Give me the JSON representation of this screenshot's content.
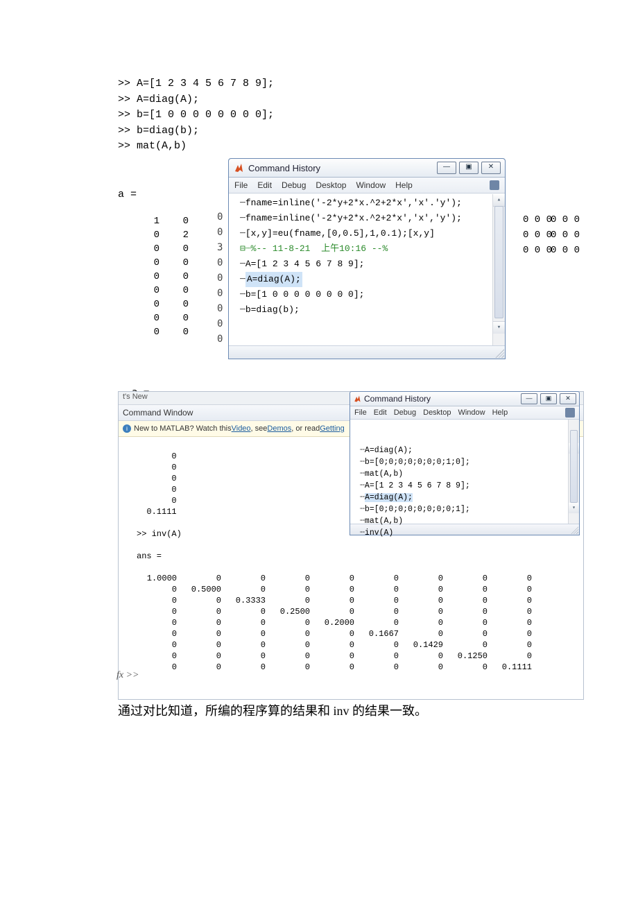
{
  "shot1": {
    "cmd_lines": ">> A=[1 2 3 4 5 6 7 8 9];\n>> A=diag(A);\n>> b=[1 0 0 0 0 0 0 0 0];\n>> b=diag(b);\n>> mat(A,b)",
    "a_equals": "a =",
    "matrix_left": [
      [
        "1",
        "0"
      ],
      [
        "0",
        "2"
      ],
      [
        "0",
        "0"
      ],
      [
        "0",
        "0"
      ],
      [
        "0",
        "0"
      ],
      [
        "0",
        "0"
      ],
      [
        "0",
        "0"
      ],
      [
        "0",
        "0"
      ],
      [
        "0",
        "0"
      ]
    ],
    "gutter": "0\n0\n3\n0\n0\n0\n0\n0\n0",
    "right_col": [
      "0",
      "0",
      "0",
      "0",
      "0",
      "0",
      "0",
      "0",
      "0"
    ],
    "a_bottom": "a ="
  },
  "winA": {
    "title": "Command History",
    "menus": [
      "File",
      "Edit",
      "Debug",
      "Desktop",
      "Window",
      "Help"
    ],
    "winbtns": {
      "min": "—",
      "max": "▣",
      "close": "✕"
    },
    "scroll": {
      "up": "▴",
      "down": "▾"
    },
    "lines": [
      {
        "text": "fname=inline('-2*y+2*x.^2+2*x','x'.'y');",
        "sel": false
      },
      {
        "text": "fname=inline('-2*y+2*x.^2+2*x','x','y');",
        "sel": false
      },
      {
        "text": "[x,y]=eu(fname,[0,0.5],1,0.1);[x,y]",
        "sel": false
      },
      {
        "text": "%-- 11-8-21  上午10:16 --%",
        "sel": false,
        "green": true,
        "toggle": "⊟"
      },
      {
        "text": "A=[1 2 3 4 5 6 7 8 9];",
        "sel": false
      },
      {
        "text": "A=diag(A);",
        "sel": true
      },
      {
        "text": "b=[1 0 0 0 0 0 0 0 0];",
        "sel": false
      },
      {
        "text": "b=diag(b);",
        "sel": false
      }
    ]
  },
  "shot2": {
    "wsbar": "t's New",
    "cwbar": "Command Window",
    "info_prefix": "New to MATLAB? Watch this ",
    "info_link1": "Video",
    "info_mid": ", see ",
    "info_link2": "Demos",
    "info_suffix": ", or read ",
    "info_link3": "Getting",
    "leading_zeros": [
      "0",
      "0",
      "0",
      "0",
      "0",
      "0.1111"
    ],
    "inv_cmd": ">> inv(A)",
    "ans_label": "ans =",
    "matrix": [
      [
        "1.0000",
        "0",
        "0",
        "0",
        "0",
        "0",
        "0",
        "0",
        "0"
      ],
      [
        "0",
        "0.5000",
        "0",
        "0",
        "0",
        "0",
        "0",
        "0",
        "0"
      ],
      [
        "0",
        "0",
        "0.3333",
        "0",
        "0",
        "0",
        "0",
        "0",
        "0"
      ],
      [
        "0",
        "0",
        "0",
        "0.2500",
        "0",
        "0",
        "0",
        "0",
        "0"
      ],
      [
        "0",
        "0",
        "0",
        "0",
        "0.2000",
        "0",
        "0",
        "0",
        "0"
      ],
      [
        "0",
        "0",
        "0",
        "0",
        "0",
        "0.1667",
        "0",
        "0",
        "0"
      ],
      [
        "0",
        "0",
        "0",
        "0",
        "0",
        "0",
        "0.1429",
        "0",
        "0"
      ],
      [
        "0",
        "0",
        "0",
        "0",
        "0",
        "0",
        "0",
        "0.1250",
        "0"
      ],
      [
        "0",
        "0",
        "0",
        "0",
        "0",
        "0",
        "0",
        "0",
        "0.1111"
      ]
    ],
    "fx": "fx >>"
  },
  "winB": {
    "title": "Command History",
    "menus": [
      "File",
      "Edit",
      "Debug",
      "Desktop",
      "Window",
      "Help"
    ],
    "winbtns": {
      "min": "—",
      "max": "▣",
      "close": "✕"
    },
    "scroll": {
      "up": "▴",
      "down": "▾"
    },
    "lines": [
      {
        "text": "A=diag(A);",
        "sel": false
      },
      {
        "text": "b=[0;0;0;0;0;0;0;1;0];",
        "sel": false
      },
      {
        "text": "mat(A,b)",
        "sel": false
      },
      {
        "text": "A=[1 2 3 4 5 6 7 8 9];",
        "sel": false
      },
      {
        "text": "A=diag(A);",
        "sel": true
      },
      {
        "text": "b=[0;0;0;0;0;0;0;0;1];",
        "sel": false
      },
      {
        "text": "mat(A,b)",
        "sel": false
      },
      {
        "text": "inv(A)",
        "sel": false
      }
    ]
  },
  "caption": "通过对比知道，所编的程序算的结果和 inv 的结果一致。"
}
